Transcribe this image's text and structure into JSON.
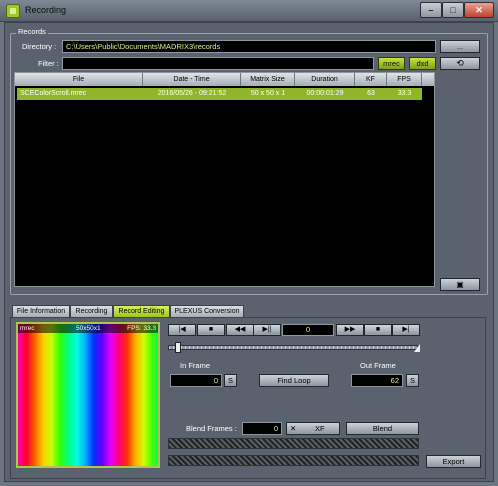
{
  "window": {
    "title": "Recording"
  },
  "records": {
    "group_label": "Records",
    "directory_label": "Directory :",
    "directory_value": "C:\\Users\\Public\\Documents\\MADRIX3\\records",
    "browse_label": "...",
    "filter_label": "Filter :",
    "filter_value": "",
    "mrec_label": "mrec",
    "dxd_label": "dxd",
    "refresh_icon": "refresh-icon",
    "delete_icon": "trash-icon"
  },
  "table": {
    "columns": [
      "File",
      "Date - Time",
      "Matrix Size",
      "Duration",
      "KF",
      "FPS"
    ],
    "rows": [
      [
        "SCEColorScroll.mrec",
        "2016/05/26 - 09:21:52",
        "50 x 50 x 1",
        "00:00:01:29",
        "63",
        "33.3"
      ]
    ]
  },
  "tabs": [
    "File Information",
    "Recording",
    "Record Editing",
    "PLEXUS Conversion"
  ],
  "active_tab": "Record Editing",
  "preview": {
    "left": "mrec",
    "center": "50x50x1",
    "right": "FPS: 33.3"
  },
  "transport": {
    "frame": "0",
    "icons": [
      "skip-start-icon",
      "stop-icon",
      "rewind-icon",
      "play-pause-icon",
      "fast-forward-icon",
      "stop-icon",
      "skip-end-icon"
    ]
  },
  "editing": {
    "in_frame_label": "In Frame",
    "in_frame_value": "0",
    "set_label": "S",
    "find_loop_label": "Find Loop",
    "out_frame_label": "Out Frame",
    "out_frame_value": "62",
    "blend_frames_label": "Blend Frames :",
    "blend_frames_value": "0",
    "xf_label": "XF",
    "blend_label": "Blend",
    "export_label": "Export"
  },
  "colors": {
    "accent": "#9ec72c",
    "field_text": "#e7f17a",
    "background": "#5a636d"
  }
}
